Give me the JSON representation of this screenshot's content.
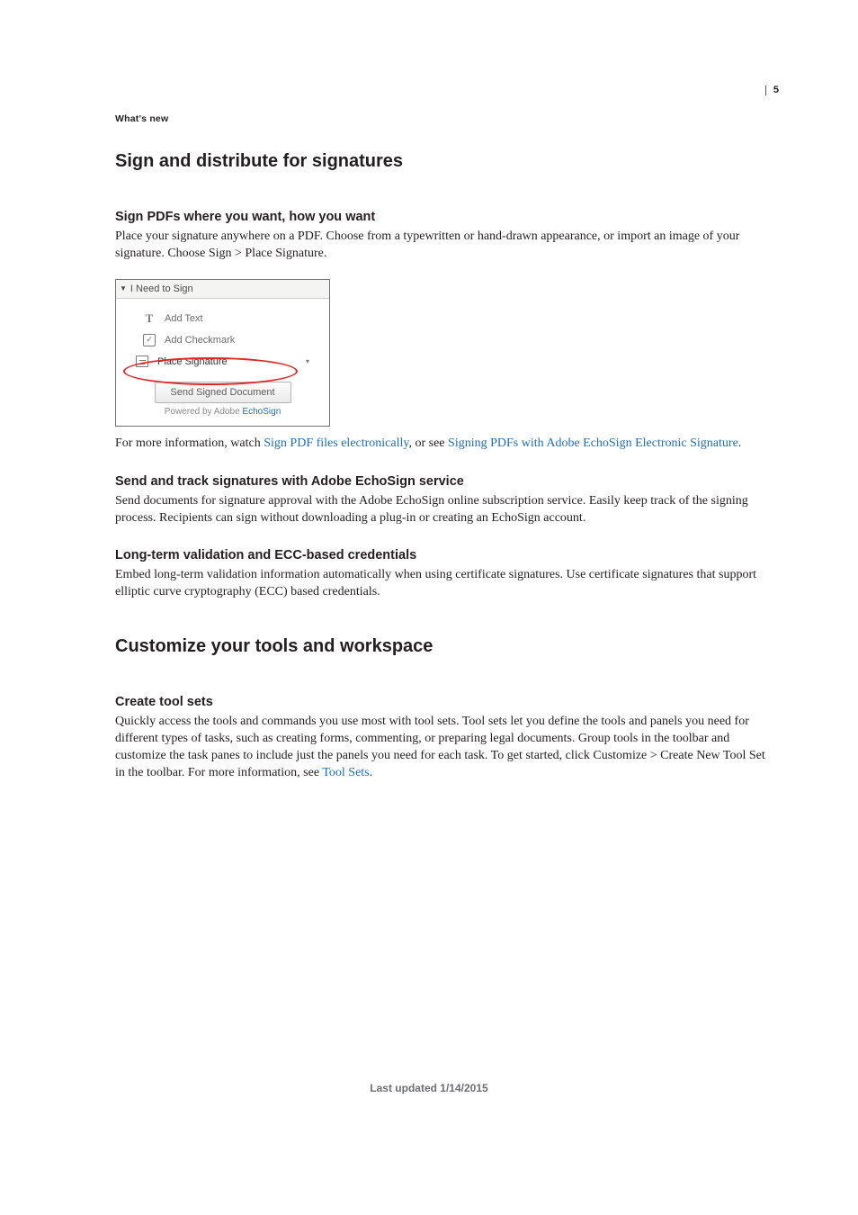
{
  "page_number": "5",
  "running_head": "What's new",
  "h1_1": "Sign and distribute for signatures",
  "sec1": {
    "h2": "Sign PDFs where you want, how you want",
    "p1": "Place your signature anywhere on a PDF. Choose from a typewritten or hand-drawn appearance, or import an image of your signature. Choose Sign > Place Signature.",
    "panel": {
      "header": "I Need to Sign",
      "add_text": "Add Text",
      "add_checkmark": "Add Checkmark",
      "place_signature": "Place Signature",
      "send_btn": "Send Signed Document",
      "powered_prefix": "Powered by Adobe ",
      "powered_link": "EchoSign"
    },
    "p2_a": "For more information, watch ",
    "p2_link1": "Sign PDF files electronically",
    "p2_b": ", or see ",
    "p2_link2": "Signing PDFs with Adobe EchoSign Electronic Signature",
    "p2_c": "."
  },
  "sec2": {
    "h2": "Send and track signatures with Adobe EchoSign service",
    "p": "Send documents for signature approval with the Adobe EchoSign online subscription service. Easily keep track of the signing process. Recipients can sign without downloading a plug-in or creating an EchoSign account."
  },
  "sec3": {
    "h2": "Long-term validation and ECC-based credentials",
    "p": "Embed long-term validation information automatically when using certificate signatures. Use certificate signatures that support elliptic curve cryptography (ECC) based credentials."
  },
  "h1_2": "Customize your tools and workspace",
  "sec4": {
    "h2": "Create tool sets",
    "p_a": "Quickly access the tools and commands you use most with tool sets. Tool sets let you define the tools and panels you need for different types of tasks, such as creating forms, commenting, or preparing legal documents. Group tools in the toolbar and customize the task panes to include just the panels you need for each task. To get started, click Customize > Create New Tool Set in the toolbar. For more information, see ",
    "p_link": "Tool Sets",
    "p_b": "."
  },
  "footer": "Last updated 1/14/2015"
}
